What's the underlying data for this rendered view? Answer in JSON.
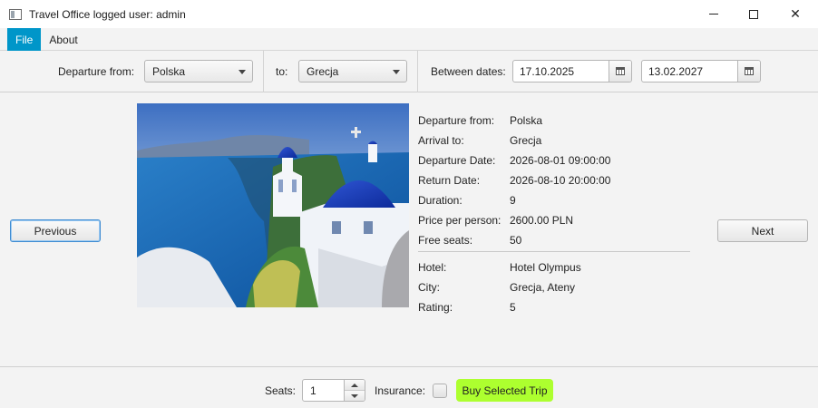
{
  "window": {
    "title": "Travel Office logged user: admin",
    "icons": {
      "app": "app-window-icon",
      "minimize": "minimize-icon",
      "maximize": "maximize-icon",
      "close": "close-icon"
    },
    "close_glyph": "✕"
  },
  "menu": {
    "items": [
      {
        "label": "File",
        "active": true
      },
      {
        "label": "About",
        "active": false
      }
    ]
  },
  "filters": {
    "departure_label": "Departure from:",
    "departure_value": "Polska",
    "to_label": "to:",
    "to_value": "Grecja",
    "dates_label": "Between dates:",
    "date_from": "17.10.2025",
    "date_to": "13.02.2027",
    "icons": {
      "dropdown": "chevron-down-icon",
      "calendar": "calendar-icon"
    }
  },
  "navigation": {
    "previous_label": "Previous",
    "next_label": "Next"
  },
  "trip": {
    "image": "santorini-church-photo",
    "details": [
      {
        "label": "Departure from:",
        "value": "Polska"
      },
      {
        "label": "Arrival to:",
        "value": "Grecja"
      },
      {
        "label": "Departure Date:",
        "value": "2026-08-01 09:00:00"
      },
      {
        "label": "Return Date:",
        "value": "2026-08-10 20:00:00"
      },
      {
        "label": "Duration:",
        "value": "9"
      },
      {
        "label": "Price per person:",
        "value": "2600.00 PLN"
      },
      {
        "label": "Free seats:",
        "value": "50"
      }
    ],
    "hotel": [
      {
        "label": "Hotel:",
        "value": "Hotel Olympus"
      },
      {
        "label": "City:",
        "value": "Grecja, Ateny"
      },
      {
        "label": "Rating:",
        "value": "5"
      }
    ]
  },
  "purchase": {
    "seats_label": "Seats:",
    "seats_value": "1",
    "insurance_label": "Insurance:",
    "insurance_checked": false,
    "buy_label": "Buy Selected Trip"
  },
  "colors": {
    "accent": "#0096c9",
    "buy_button": "#adff2f",
    "focus": "#3e8bd1",
    "background": "#f3f3f3"
  }
}
